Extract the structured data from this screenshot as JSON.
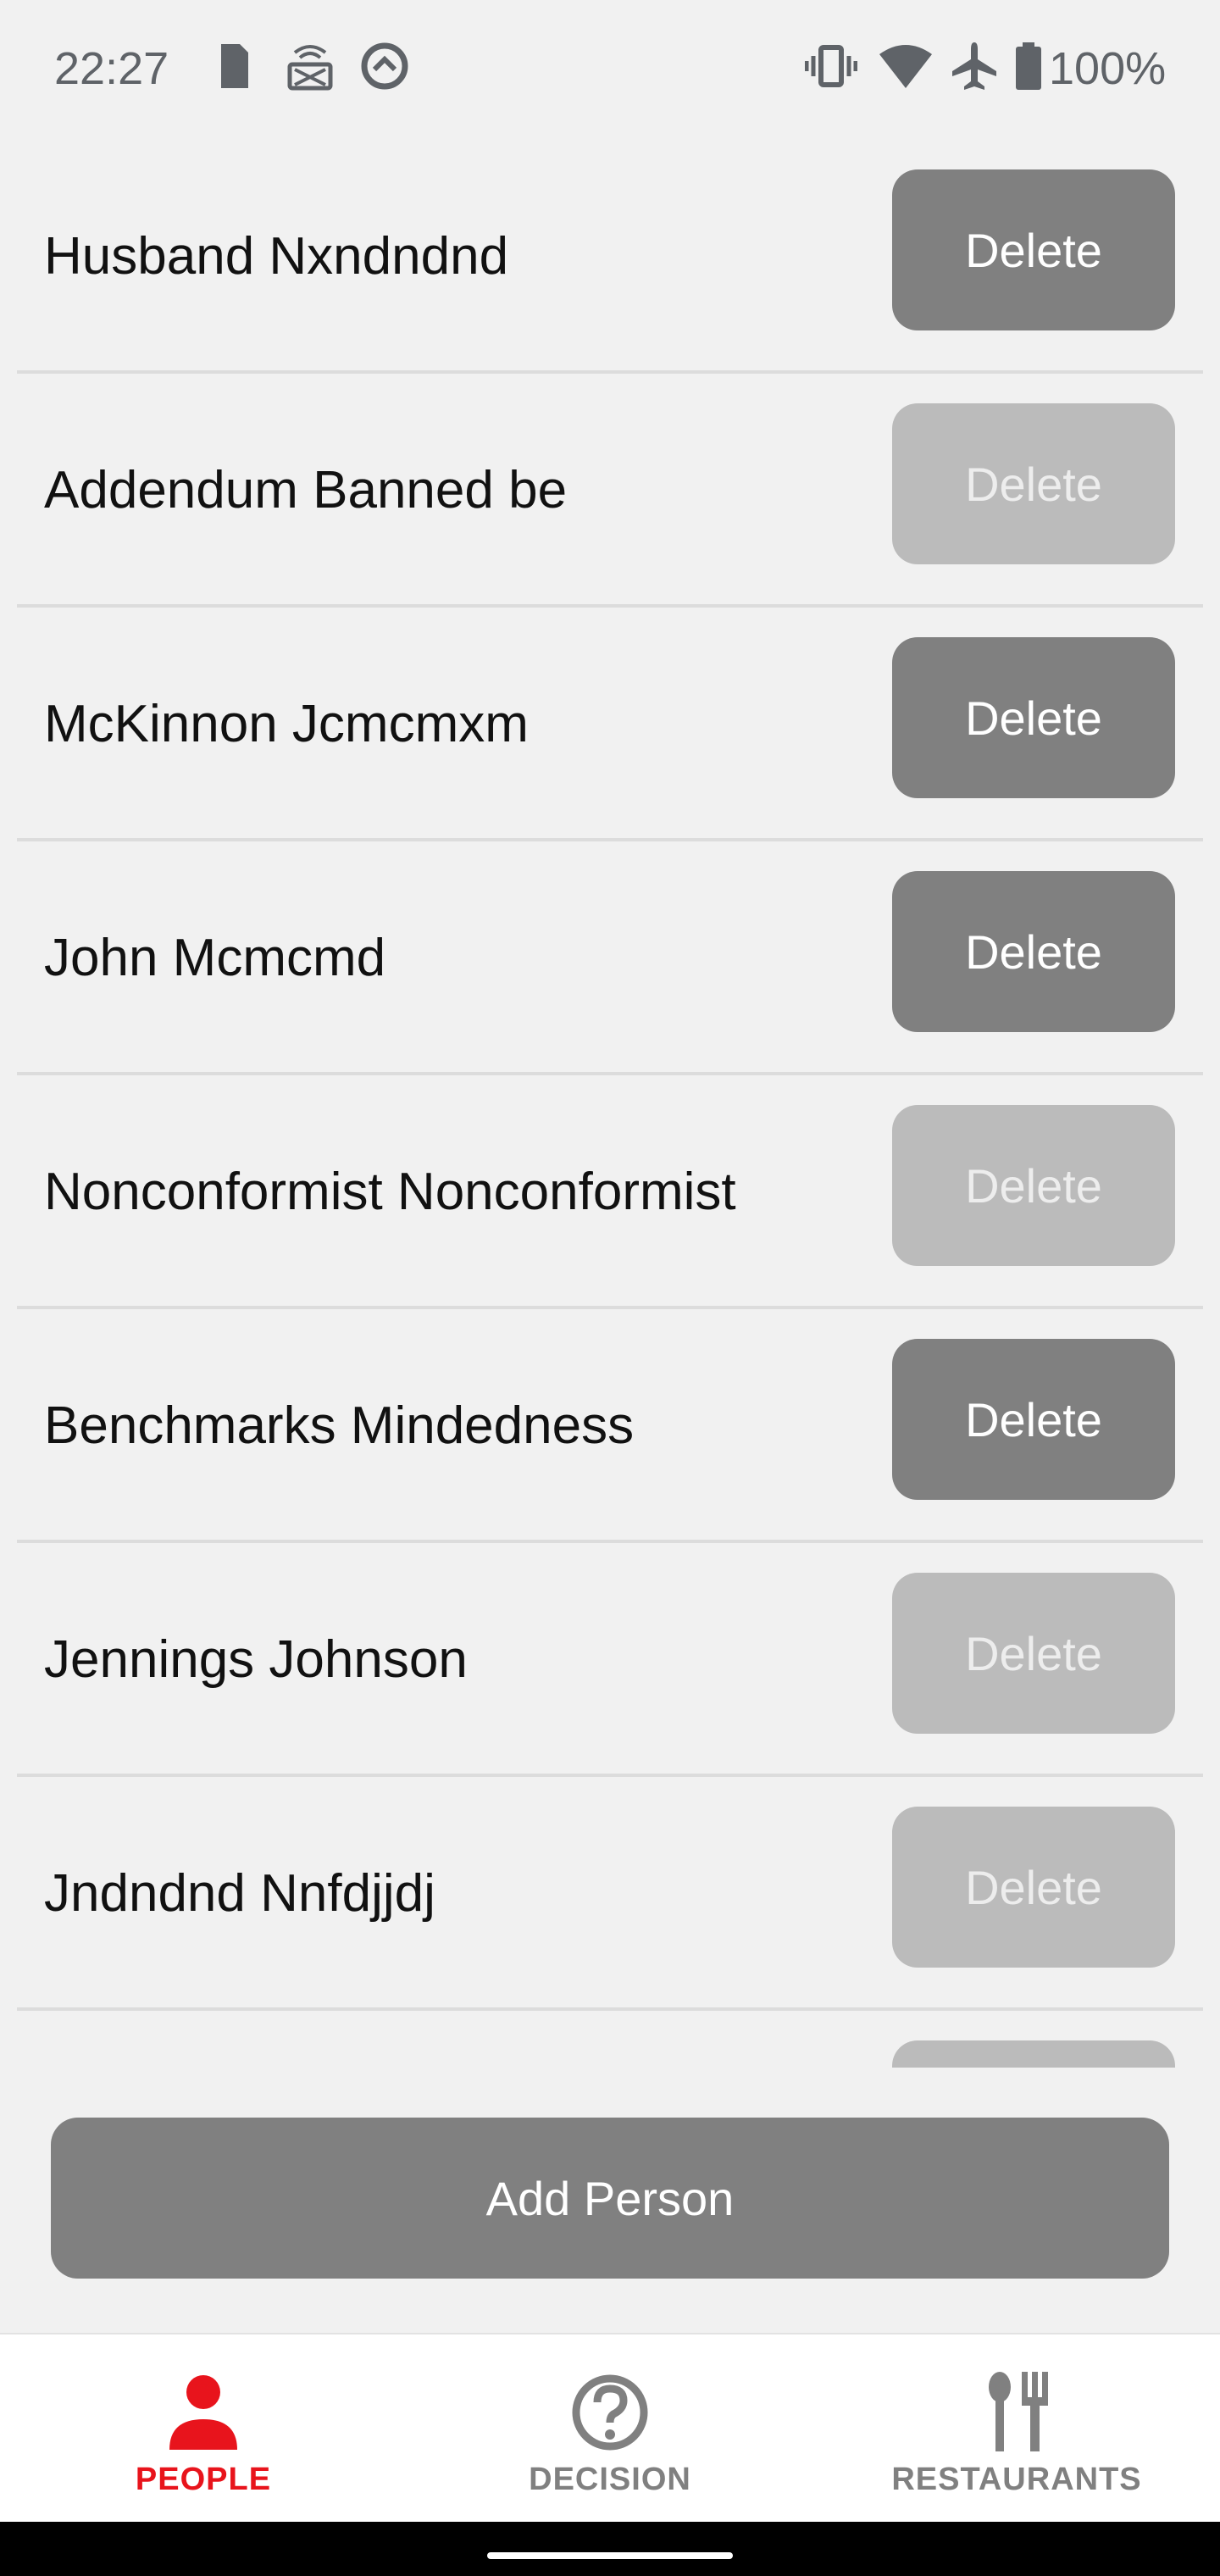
{
  "status_bar": {
    "time": "22:27",
    "battery": "100%",
    "icons": [
      "sim-icon",
      "cast-icon",
      "data-saver-icon",
      "vibrate-icon",
      "wifi-icon",
      "airplane-icon",
      "battery-icon"
    ]
  },
  "people": [
    {
      "name": "Husband Nxndndnd",
      "delete_label": "Delete",
      "enabled": true
    },
    {
      "name": "Addendum Banned be",
      "delete_label": "Delete",
      "enabled": false
    },
    {
      "name": "McKinnon Jcmcmxm",
      "delete_label": "Delete",
      "enabled": true
    },
    {
      "name": "John Mcmcmd",
      "delete_label": "Delete",
      "enabled": true
    },
    {
      "name": "Nonconformist Nonconformist",
      "delete_label": "Delete",
      "enabled": false
    },
    {
      "name": "Benchmarks Mindedness",
      "delete_label": "Delete",
      "enabled": true
    },
    {
      "name": "Jennings Johnson",
      "delete_label": "Delete",
      "enabled": false
    },
    {
      "name": "Jndndnd Nnfdjjdj",
      "delete_label": "Delete",
      "enabled": false
    }
  ],
  "add_button": {
    "label": "Add Person"
  },
  "bottom_nav": {
    "items": [
      {
        "label": "PEOPLE",
        "icon": "person-icon",
        "active": true
      },
      {
        "label": "DECISION",
        "icon": "question-icon",
        "active": false
      },
      {
        "label": "RESTAURANTS",
        "icon": "restaurant-icon",
        "active": false
      }
    ]
  },
  "colors": {
    "active": "#e8141c",
    "inactive": "#808080",
    "button_enabled": "#808080",
    "button_disabled": "#bbbbbb",
    "background": "#f1f1f1"
  }
}
